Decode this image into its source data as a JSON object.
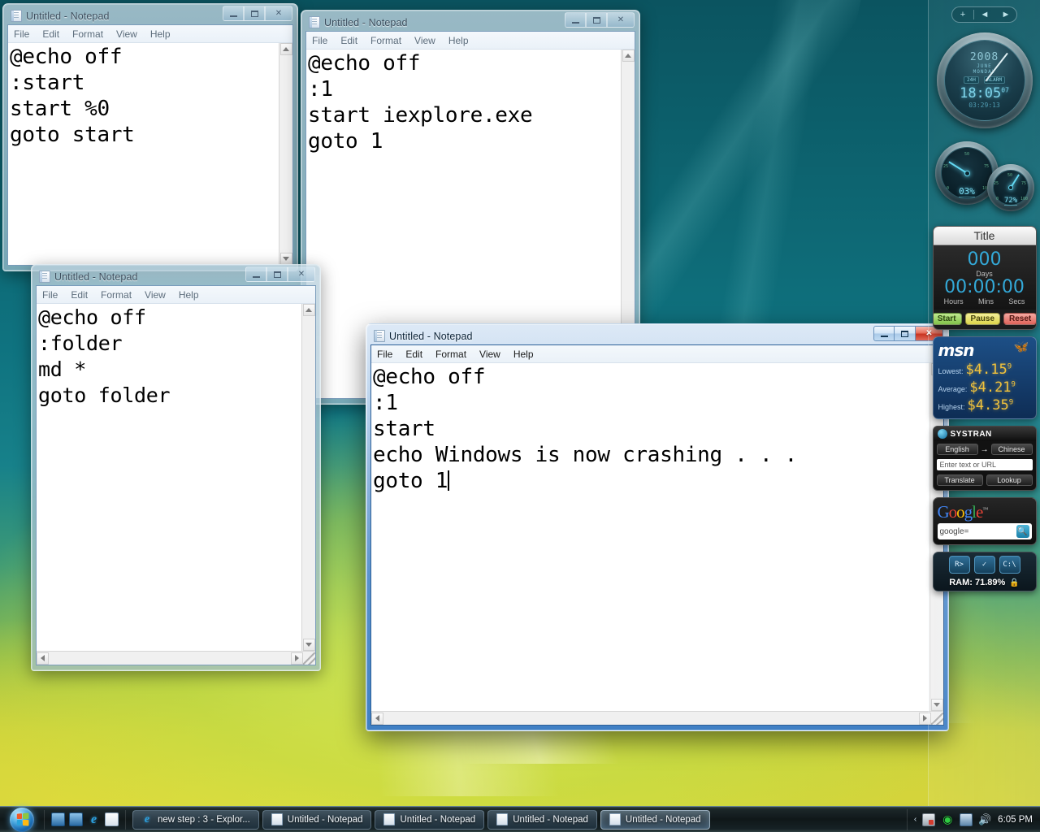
{
  "desktop": {
    "os": "Windows Vista",
    "wallpaper_colors": [
      "#0b5460",
      "#0f7380",
      "#86b84e",
      "#d6d23a"
    ]
  },
  "windows": [
    {
      "id": "win1",
      "title": "Untitled - Notepad",
      "icon": "notepad-icon",
      "active": false,
      "menu": [
        "File",
        "Edit",
        "Format",
        "View",
        "Help"
      ],
      "text": "@echo off\n:start\nstart %0\ngoto start"
    },
    {
      "id": "win2",
      "title": "Untitled - Notepad",
      "icon": "notepad-icon",
      "active": false,
      "menu": [
        "File",
        "Edit",
        "Format",
        "View",
        "Help"
      ],
      "text": "@echo off\n:1\nstart iexplore.exe\ngoto 1"
    },
    {
      "id": "win3",
      "title": "Untitled - Notepad",
      "icon": "notepad-icon",
      "active": false,
      "menu": [
        "File",
        "Edit",
        "Format",
        "View",
        "Help"
      ],
      "text": "@echo off\n:folder\nmd *\ngoto folder"
    },
    {
      "id": "win4",
      "title": "Untitled - Notepad",
      "icon": "notepad-icon",
      "active": true,
      "menu": [
        "File",
        "Edit",
        "Format",
        "View",
        "Help"
      ],
      "text": "@echo off\n:1\nstart\necho Windows is now crashing . . .\ngoto 1"
    }
  ],
  "sidebar": {
    "header": {
      "add_label": "+",
      "prev_label": "◄",
      "next_label": "►"
    },
    "clock": {
      "year": "2008",
      "month": "JUNE",
      "day": "MONDAY",
      "mode_chip": "24H",
      "alarm_chip": "ALARM",
      "time": "18:05",
      "seconds": "07",
      "secondary": "03:29:13"
    },
    "cpu_meter": {
      "value": "03%",
      "ticks": [
        "0",
        "25",
        "50",
        "75",
        "100"
      ]
    },
    "ram_meter": {
      "value": "72%",
      "ticks": [
        "0",
        "25",
        "50",
        "75",
        "100"
      ]
    },
    "timer": {
      "title": "Title",
      "days": "000",
      "days_label": "Days",
      "clock": "00:00:00",
      "units": [
        "Hours",
        "Mins",
        "Secs"
      ],
      "buttons": [
        "Start",
        "Pause",
        "Reset"
      ]
    },
    "gas": {
      "brand": "msn",
      "rows": [
        {
          "label": "Lowest:",
          "price": "$4.15",
          "sup": "9"
        },
        {
          "label": "Average:",
          "price": "$4.21",
          "sup": "9"
        },
        {
          "label": "Highest:",
          "price": "$4.35",
          "sup": "9"
        }
      ]
    },
    "systran": {
      "name": "SYSTRAN",
      "from_lang": "English",
      "to_lang": "Chinese",
      "arrow": "→",
      "input_placeholder": "Enter text or URL",
      "buttons": [
        "Translate",
        "Lookup"
      ]
    },
    "google": {
      "logo_letters": [
        "G",
        "o",
        "o",
        "g",
        "l",
        "e"
      ],
      "tm": "™",
      "query": "google=",
      "search_icon": "magnifier-icon"
    },
    "sysmon": {
      "buttons": [
        "R>",
        "✓",
        "C:\\"
      ],
      "ram_label": "RAM: 71.89%",
      "lock_icon": "lock-icon"
    }
  },
  "taskbar": {
    "start_label": "Start",
    "quicklaunch": [
      {
        "name": "show-desktop",
        "label": ""
      },
      {
        "name": "flip3d",
        "label": ""
      },
      {
        "name": "internet-explorer",
        "label": "e"
      },
      {
        "name": "notepad",
        "label": ""
      }
    ],
    "tasks": [
      {
        "label": "new step : 3 - Explor...",
        "icon": "ie-icon",
        "active": false
      },
      {
        "label": "Untitled - Notepad",
        "icon": "notepad-icon",
        "active": false
      },
      {
        "label": "Untitled - Notepad",
        "icon": "notepad-icon",
        "active": false
      },
      {
        "label": "Untitled - Notepad",
        "icon": "notepad-icon",
        "active": false
      },
      {
        "label": "Untitled - Notepad",
        "icon": "notepad-icon",
        "active": true
      }
    ],
    "tray": {
      "chevron": "‹",
      "icons": [
        "network-status-icon",
        "security-shield-icon",
        "network-connection-icon",
        "volume-icon"
      ],
      "clock": "6:05 PM"
    }
  }
}
